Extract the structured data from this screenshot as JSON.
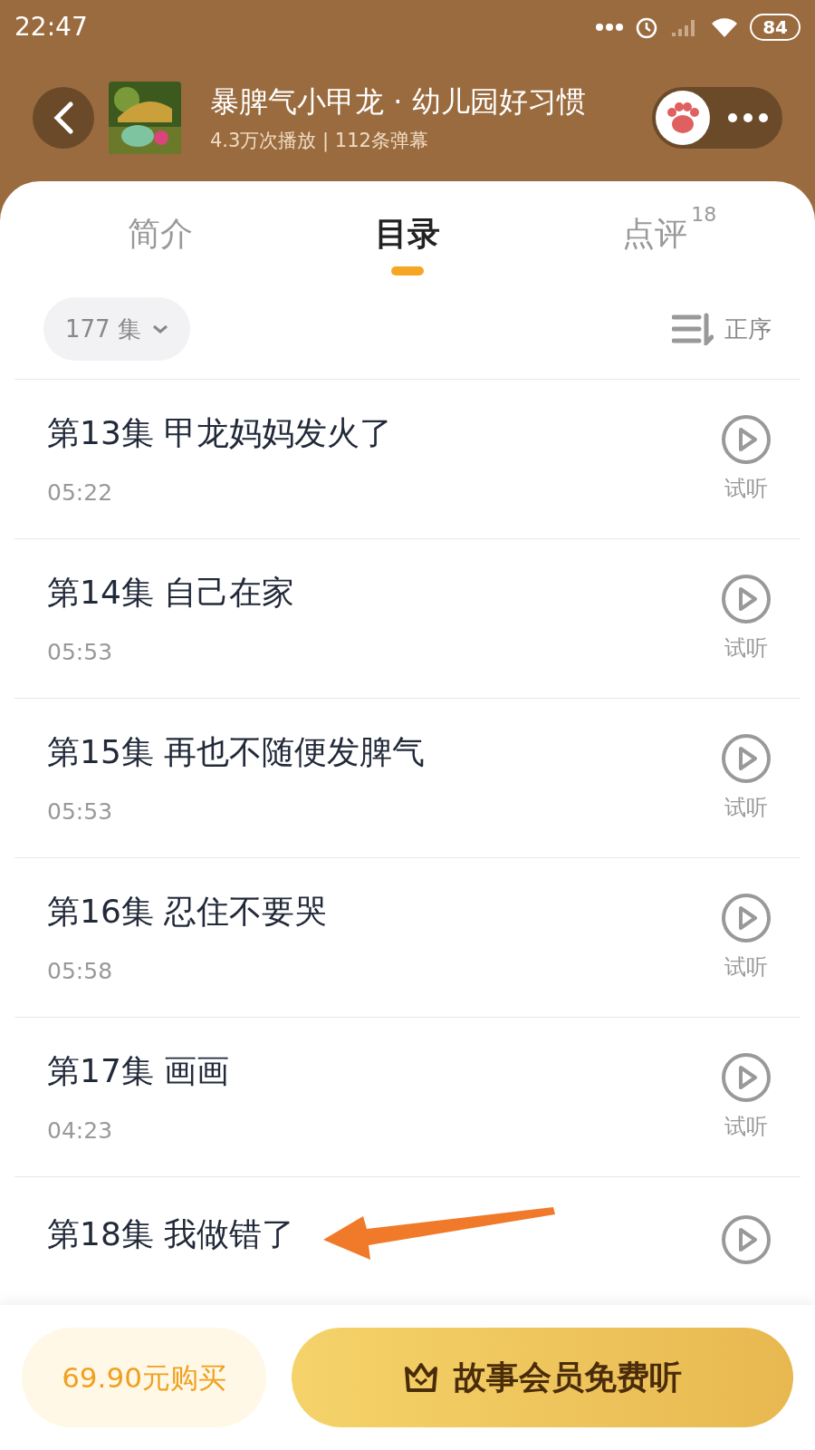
{
  "status_bar": {
    "time": "22:47",
    "battery": "84"
  },
  "header": {
    "title": "暴脾气小甲龙 · 幼儿园好习惯",
    "subtitle": "4.3万次播放 | 112条弹幕"
  },
  "tabs": [
    {
      "label": "简介",
      "selected": false
    },
    {
      "label": "目录",
      "selected": true
    },
    {
      "label": "点评",
      "selected": false,
      "badge": "18"
    }
  ],
  "filter": {
    "episodes": "177 集",
    "sort": "正序"
  },
  "episodes": [
    {
      "title": "第13集 甲龙妈妈发火了",
      "duration": "05:22",
      "action": "试听"
    },
    {
      "title": "第14集 自己在家",
      "duration": "05:53",
      "action": "试听"
    },
    {
      "title": "第15集 再也不随便发脾气",
      "duration": "05:53",
      "action": "试听"
    },
    {
      "title": "第16集 忍住不要哭",
      "duration": "05:58",
      "action": "试听"
    },
    {
      "title": "第17集 画画",
      "duration": "04:23",
      "action": "试听"
    },
    {
      "title": "第18集 我做错了"
    }
  ],
  "bottom_bar": {
    "buy": "69.90元购买",
    "member": "故事会员免费听"
  }
}
